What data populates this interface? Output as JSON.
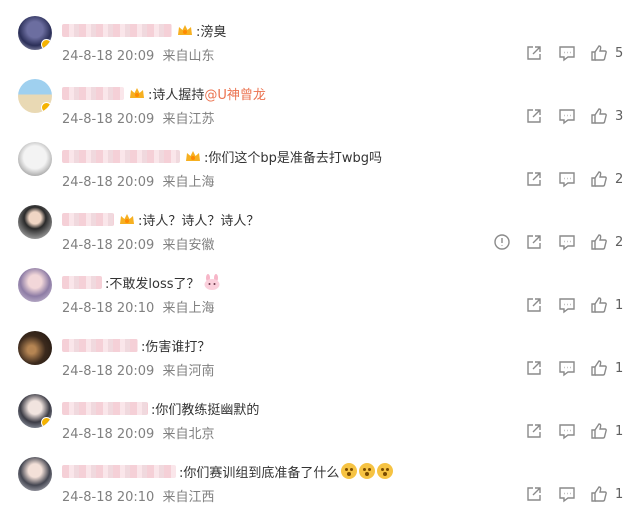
{
  "comments": [
    {
      "text": ":滂臭",
      "date": "24-8-18 20:09",
      "location": "来自山东",
      "likes": "5"
    },
    {
      "text": ":诗人握持",
      "mention": "@U神曾龙",
      "date": "24-8-18 20:09",
      "location": "来自江苏",
      "likes": "3"
    },
    {
      "text": ":你们这个bp是准备去打wbg吗",
      "date": "24-8-18 20:09",
      "location": "来自上海",
      "likes": "2"
    },
    {
      "text": ":诗人？诗人？诗人？",
      "date": "24-8-18 20:09",
      "location": "来自安徽",
      "likes": "2"
    },
    {
      "text": ":不敢发loss了？",
      "date": "24-8-18 20:10",
      "location": "来自上海",
      "likes": "1"
    },
    {
      "text": ":伤害谁打？",
      "date": "24-8-18 20:09",
      "location": "来自河南",
      "likes": "1"
    },
    {
      "text": ":你们教练挺幽默的",
      "date": "24-8-18 20:09",
      "location": "来自北京",
      "likes": "1"
    },
    {
      "text": ":你们赛训组到底准备了什么",
      "date": "24-8-18 20:10",
      "location": "来自江西",
      "likes": "1"
    }
  ],
  "icons": {
    "share": "share-icon",
    "comment": "comment-icon",
    "like": "like-icon",
    "report": "report-icon"
  },
  "colors": {
    "mention": "#eb7350",
    "meta": "#808080",
    "icon": "#8a8a8a"
  }
}
